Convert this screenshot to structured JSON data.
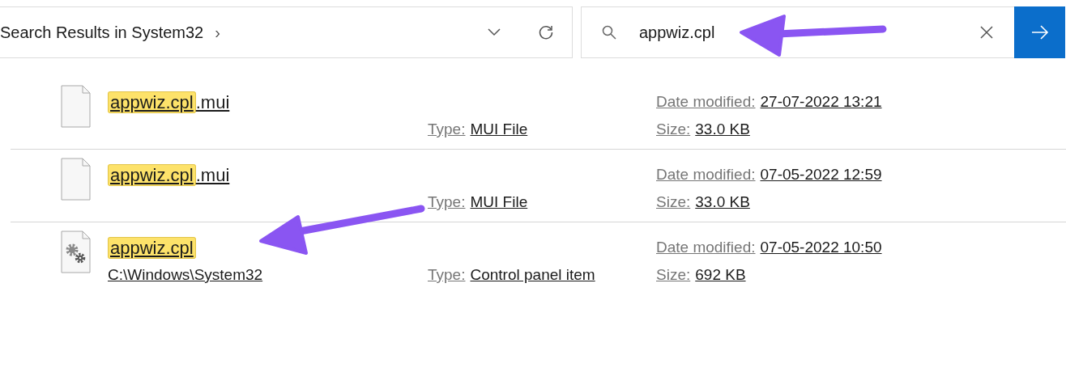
{
  "address_bar": {
    "location": "Search Results in System32",
    "separator": "›"
  },
  "search": {
    "value": "appwiz.cpl"
  },
  "results": [
    {
      "kind": "file",
      "name_match": "appwiz.cpl",
      "name_rest": ".mui",
      "type_label": "Type:",
      "type": "MUI File",
      "date_label": "Date modified:",
      "date": "27-07-2022 13:21",
      "size_label": "Size:",
      "size": "33.0 KB"
    },
    {
      "kind": "file",
      "name_match": "appwiz.cpl",
      "name_rest": ".mui",
      "type_label": "Type:",
      "type": "MUI File",
      "date_label": "Date modified:",
      "date": "07-05-2022 12:59",
      "size_label": "Size:",
      "size": "33.0 KB"
    },
    {
      "kind": "control_panel",
      "name_match": "appwiz.cpl",
      "path": "C:\\Windows\\System32",
      "type_label": "Type:",
      "type": "Control panel item",
      "date_label": "Date modified:",
      "date": "07-05-2022 10:50",
      "size_label": "Size:",
      "size": "692 KB"
    }
  ]
}
